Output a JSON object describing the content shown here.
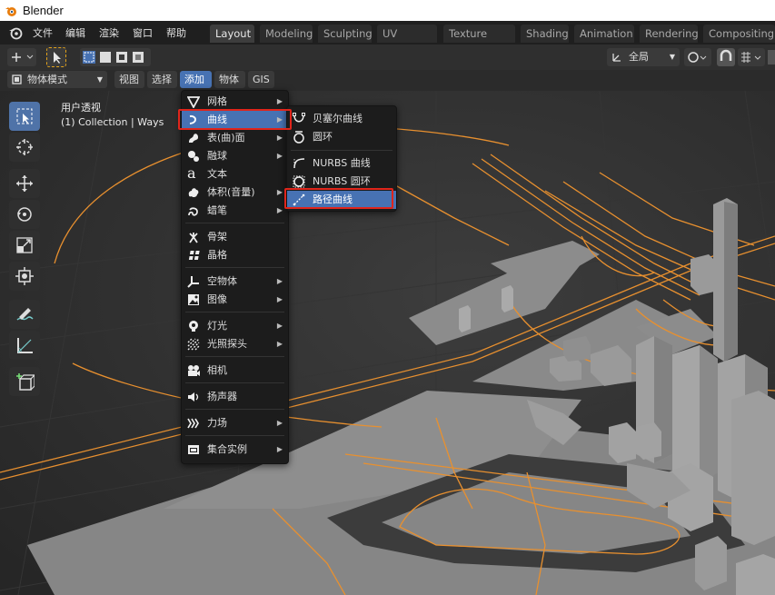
{
  "window": {
    "title": "Blender"
  },
  "top_menu": [
    "文件",
    "编辑",
    "渲染",
    "窗口",
    "帮助"
  ],
  "workspace_tabs": [
    "Layout",
    "Modeling",
    "Sculpting",
    "UV Editing",
    "Texture Paint",
    "Shading",
    "Animation",
    "Rendering",
    "Compositing"
  ],
  "active_workspace": "Layout",
  "toolbar": {
    "transform_orientation": "全局"
  },
  "header": {
    "mode": "物体模式",
    "view": "视图",
    "select": "选择",
    "add": "添加",
    "object": "物体",
    "gis": "GIS"
  },
  "viewport": {
    "view_name": "用户透视",
    "collection": "(1) Collection | Ways"
  },
  "add_menu": {
    "items": [
      {
        "label": "网格",
        "icon": "mesh-icon",
        "submenu": true
      },
      {
        "label": "曲线",
        "icon": "curve-icon",
        "submenu": true,
        "highlighted": true
      },
      {
        "label": "表(曲)面",
        "icon": "surface-icon",
        "submenu": true
      },
      {
        "label": "融球",
        "icon": "metaball-icon",
        "submenu": true
      },
      {
        "label": "文本",
        "icon": "text-icon",
        "submenu": false
      },
      {
        "label": "体积(音量)",
        "icon": "volume-icon",
        "submenu": true
      },
      {
        "label": "蜡笔",
        "icon": "grease-pencil-icon",
        "submenu": true
      },
      {
        "label": "骨架",
        "icon": "armature-icon",
        "submenu": false
      },
      {
        "label": "晶格",
        "icon": "lattice-icon",
        "submenu": false
      },
      {
        "label": "空物体",
        "icon": "empty-icon",
        "submenu": true
      },
      {
        "label": "图像",
        "icon": "image-icon",
        "submenu": true
      },
      {
        "label": "灯光",
        "icon": "light-icon",
        "submenu": true
      },
      {
        "label": "光照探头",
        "icon": "light-probe-icon",
        "submenu": true
      },
      {
        "label": "相机",
        "icon": "camera-icon",
        "submenu": false
      },
      {
        "label": "扬声器",
        "icon": "speaker-icon",
        "submenu": false
      },
      {
        "label": "力场",
        "icon": "force-field-icon",
        "submenu": true
      },
      {
        "label": "集合实例",
        "icon": "collection-instance-icon",
        "submenu": true
      }
    ]
  },
  "curve_submenu": {
    "items": [
      {
        "label": "贝塞尔曲线",
        "icon": "bezier-curve-icon"
      },
      {
        "label": "圆环",
        "icon": "bezier-circle-icon"
      },
      {
        "label": "NURBS 曲线",
        "icon": "nurbs-curve-icon"
      },
      {
        "label": "NURBS 圆环",
        "icon": "nurbs-circle-icon"
      },
      {
        "label": "路径曲线",
        "icon": "path-curve-icon",
        "highlighted": true
      }
    ]
  },
  "colors": {
    "highlight": "#4772b3",
    "annotation_red": "#e0251b",
    "roads": "#e8902f",
    "buildings": "#8a8a8a"
  }
}
